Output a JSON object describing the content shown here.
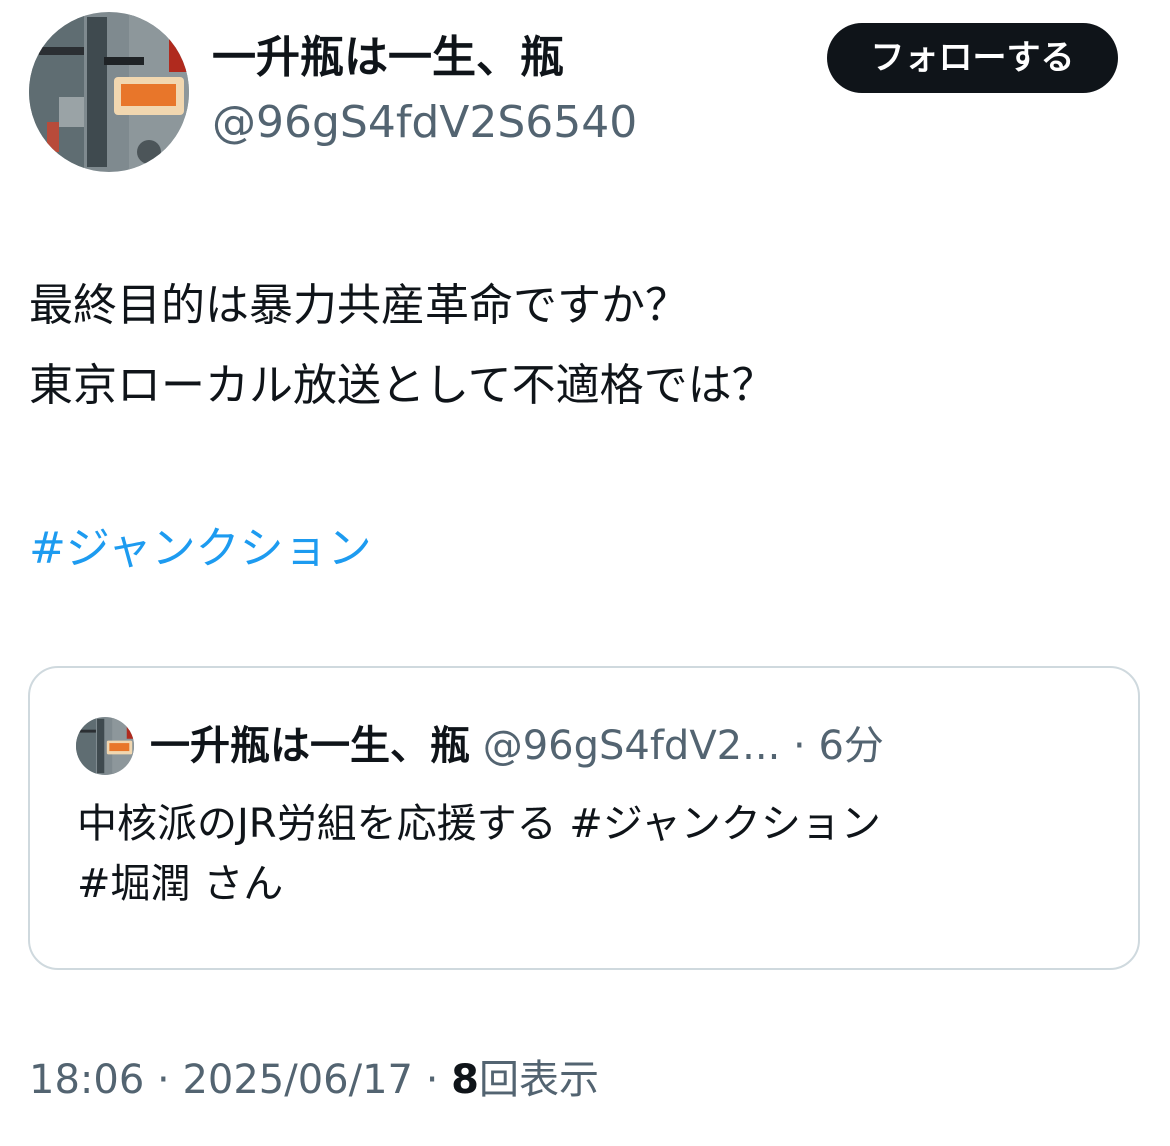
{
  "author": {
    "display_name": "一升瓶は一生、瓶",
    "handle": "@96gS4fdV2S6540",
    "avatar_icon": "abstract-painting-avatar"
  },
  "follow_button": {
    "label": "フォローする"
  },
  "tweet": {
    "lines": [
      "最終目的は暴力共産革命ですか？",
      "東京ローカル放送として不適格では？"
    ],
    "hashtag": "#ジャンクション"
  },
  "quoted_tweet": {
    "display_name": "一升瓶は一生、瓶",
    "handle": "@96gS4fdV2...",
    "separator": "·",
    "time": "6分",
    "text_line1": "中核派のJR労組を応援する #ジャンクション",
    "hashtag2": "#堀潤",
    "suffix": " さん"
  },
  "meta": {
    "time": "18:06",
    "separator": "·",
    "date": "2025/06/17",
    "views_count": "8",
    "views_label": "回表示"
  },
  "colors": {
    "text_primary": "#0f1419",
    "text_secondary": "#536471",
    "link": "#1d9bf0",
    "border": "#cfd9de"
  }
}
